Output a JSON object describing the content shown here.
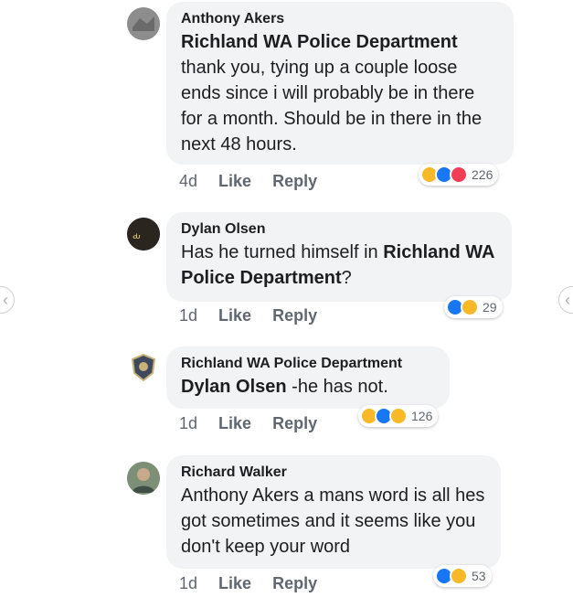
{
  "comments": [
    {
      "author": "Anthony Akers",
      "tag": "Richland WA Police Department",
      "text": "thank you, tying up a couple loose ends since i will probably be in there for a month. Should be in there in the next 48 hours.",
      "time": "4d",
      "like": "Like",
      "reply": "Reply",
      "reactions": [
        "haha",
        "like",
        "love"
      ],
      "reaction_count": "226"
    },
    {
      "author": "Dylan Olsen",
      "text_pre": "Has he turned himself in ",
      "tag": "Richland WA Police Department",
      "text_post": "?",
      "time": "1d",
      "like": "Like",
      "reply": "Reply",
      "reactions": [
        "like",
        "haha"
      ],
      "reaction_count": "29"
    },
    {
      "author": "Richland WA Police Department",
      "tag": "Dylan Olsen",
      "text": " -he has not.",
      "time": "1d",
      "like": "Like",
      "reply": "Reply",
      "reactions": [
        "haha",
        "like",
        "wow"
      ],
      "reaction_count": "126"
    },
    {
      "author": "Richard Walker",
      "text": "Anthony Akers a mans word is all hes got sometimes and it seems like you don't keep your word",
      "time": "1d",
      "like": "Like",
      "reply": "Reply",
      "reactions": [
        "like",
        "haha"
      ],
      "reaction_count": "53"
    }
  ],
  "nav": {
    "left": "‹",
    "right": "‹"
  },
  "colors": {
    "like": "#1877f2",
    "love": "#f33e58",
    "haha": "#f7b928",
    "bubble": "#f2f3f5"
  }
}
